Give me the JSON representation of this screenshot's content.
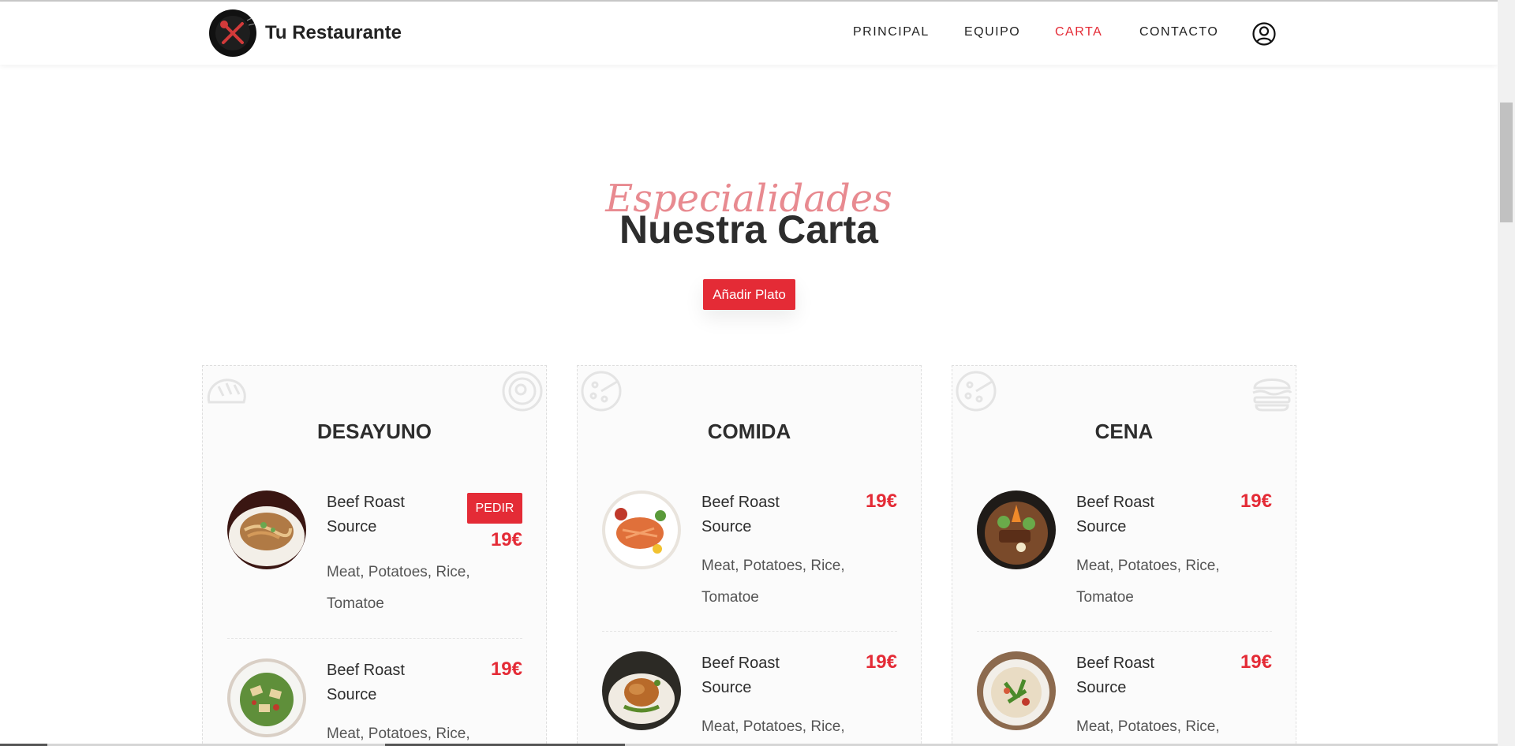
{
  "header": {
    "brand": "Tu Restaurante",
    "nav": [
      {
        "label": "PRINCIPAL",
        "active": false
      },
      {
        "label": "EQUIPO",
        "active": false
      },
      {
        "label": "CARTA",
        "active": true
      },
      {
        "label": "CONTACTO",
        "active": false
      }
    ],
    "user_icon": "user-circle-icon"
  },
  "section": {
    "script_title": "Especialidades",
    "title": "Nuestra Carta",
    "add_button": "Añadir Plato"
  },
  "colors": {
    "accent": "#e42b36",
    "script": "#e88a90",
    "dark": "#2d2d2d"
  },
  "menus": [
    {
      "title": "DESAYUNO",
      "deco_icons": [
        "bread-icon",
        "egg-pan-icon"
      ],
      "items": [
        {
          "name": "Beef Roast Source",
          "description": "Meat, Potatoes, Rice, Tomatoe",
          "price": "19€",
          "action": "PEDIR",
          "image": "noodle-plate-image"
        },
        {
          "name": "Beef Roast Source",
          "description": "Meat, Potatoes, Rice,",
          "price": "19€",
          "image": "salad-plate-image"
        }
      ]
    },
    {
      "title": "COMIDA",
      "deco_icons": [
        "pizza-icon"
      ],
      "items": [
        {
          "name": "Beef Roast Source",
          "description": "Meat, Potatoes, Rice, Tomatoe",
          "price": "19€",
          "image": "salmon-plate-image"
        },
        {
          "name": "Beef Roast Source",
          "description": "Meat, Potatoes, Rice,",
          "price": "19€",
          "image": "roast-chicken-image"
        }
      ]
    },
    {
      "title": "CENA",
      "deco_icons": [
        "pizza-icon",
        "burger-icon"
      ],
      "items": [
        {
          "name": "Beef Roast Source",
          "description": "Meat, Potatoes, Rice, Tomatoe",
          "price": "19€",
          "image": "steak-bowl-image"
        },
        {
          "name": "Beef Roast Source",
          "description": "Meat, Potatoes, Rice,",
          "price": "19€",
          "image": "soup-bowl-image"
        }
      ]
    }
  ]
}
